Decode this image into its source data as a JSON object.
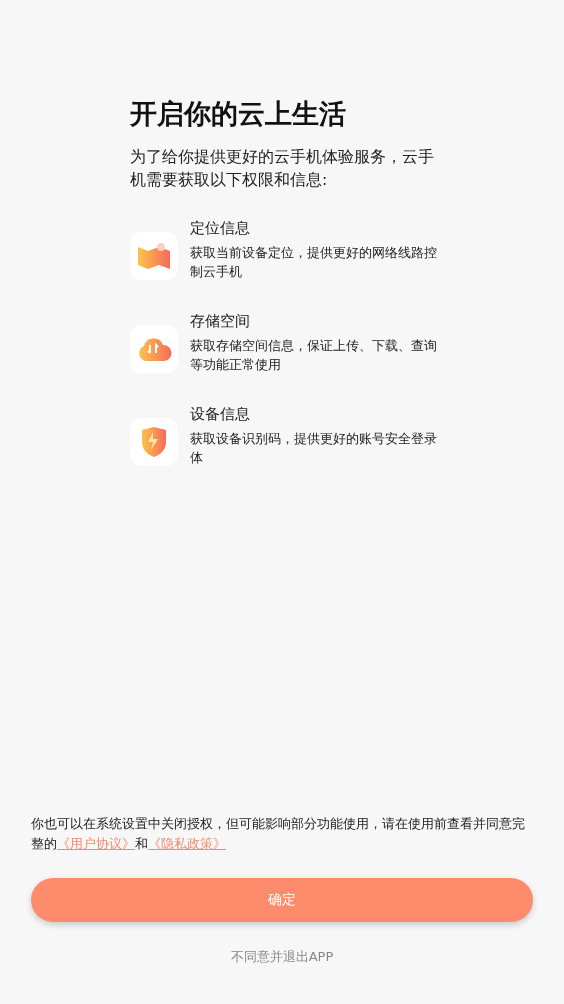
{
  "title": "开启你的云上生活",
  "intro": "为了给你提供更好的云手机体验服务，云手机需要获取以下权限和信息:",
  "permissions": [
    {
      "kind": "location",
      "title": "定位信息",
      "description": "获取当前设备定位，提供更好的网络线路控制云手机"
    },
    {
      "kind": "storage",
      "title": "存储空间",
      "description": "获取存储空间信息，保证上传、下载、查询等功能正常使用"
    },
    {
      "kind": "device",
      "title": "设备信息",
      "description": "获取设备识别码，提供更好的账号安全登录体"
    }
  ],
  "notice": [
    {
      "kind": "text",
      "text": "你也可以在系统设置中关闭授权，但可能影响部分功能使用，请在使用前查看并同意完整的"
    },
    {
      "kind": "link",
      "text": "《用户协议》"
    },
    {
      "kind": "text",
      "text": "和"
    },
    {
      "kind": "link",
      "text": "《隐私政策》"
    }
  ],
  "confirm_button": "确定",
  "exit_link": "不同意并退出APP"
}
